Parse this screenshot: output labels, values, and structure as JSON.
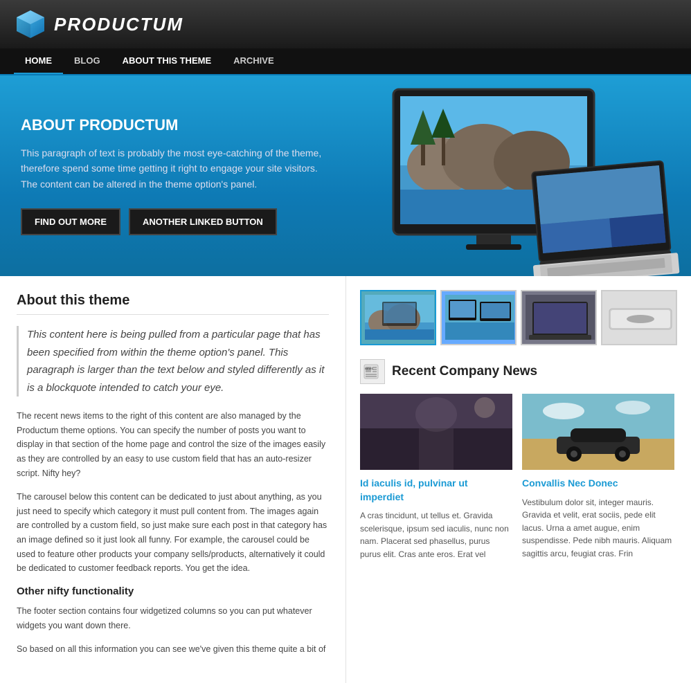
{
  "site": {
    "logo_text": "PRODUCTUM"
  },
  "nav": {
    "items": [
      {
        "label": "HOME",
        "active": true
      },
      {
        "label": "BLOG",
        "active": false
      },
      {
        "label": "ABOUT THIS THEME",
        "active": false
      },
      {
        "label": "ARCHIVE",
        "active": false
      }
    ]
  },
  "hero": {
    "title": "ABOUT PRODUCTUM",
    "text": "This paragraph of text is probably the most eye-catching of the theme, therefore spend some time getting it right to engage your site visitors. The content can be altered in the theme option's panel.",
    "btn1": "FIND OUT MORE",
    "btn2": "ANOTHER LINKED BUTTON"
  },
  "content": {
    "section_title": "About this theme",
    "blockquote": "This content here is being pulled from a particular page that has been specified from within the theme option's panel. This paragraph is larger than the text below and styled differently as it is a blockquote intended to catch your eye.",
    "para1": "The recent news items to the right of this content are also managed by the Productum theme options. You can specify the number of posts you want to display in that section of the home page and control the size of the images easily as they are controlled by an easy to use custom field that has an auto-resizer script. Nifty hey?",
    "para2": "The carousel below this content can be dedicated to just about anything, as you just need to specify which category it must pull content from. The images again are controlled by a custom field, so just make sure each post in that category has an image defined so it just look all funny. For example, the carousel could be used to feature other products your company sells/products, alternatively it could be dedicated to customer feedback reports. You get the idea.",
    "sub_title": "Other nifty functionality",
    "para3": "The footer section contains four widgetized columns so you can put whatever widgets you want down there.",
    "para4": "So based on all this information you can see we've given this theme quite a bit of"
  },
  "sidebar": {
    "thumbnails": [
      {
        "label": "Monitor thumbnail 1",
        "active": true
      },
      {
        "label": "Monitor thumbnail 2",
        "active": false
      },
      {
        "label": "Laptop thumbnail",
        "active": false
      },
      {
        "label": "Device thumbnail",
        "active": false
      }
    ],
    "recent_news_title": "Recent Company News",
    "news": [
      {
        "title": "Id iaculis id, pulvinar ut imperdiet",
        "body": "A cras tincidunt, ut tellus et. Gravida scelerisque, ipsum sed iaculis, nunc non nam. Placerat sed phasellus, purus purus elit. Cras ante eros. Erat vel"
      },
      {
        "title": "Convallis Nec Donec",
        "body": "Vestibulum dolor sit, integer mauris. Gravida et velit, erat sociis, pede elit lacus. Urna a amet augue, enim suspendisse. Pede nibh mauris. Aliquam sagittis arcu, feugiat cras. Frin"
      }
    ]
  }
}
